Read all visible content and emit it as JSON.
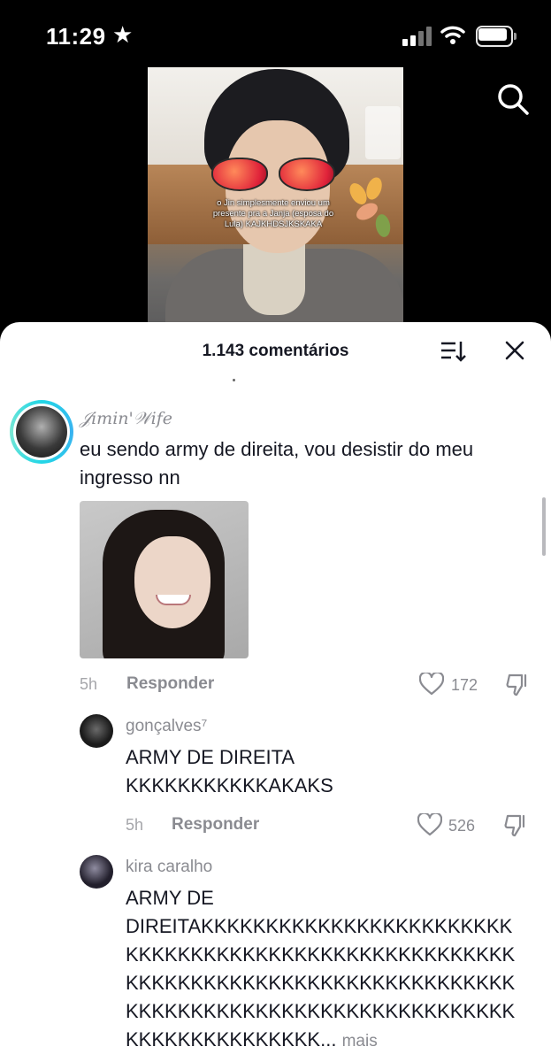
{
  "status_bar": {
    "time": "11:29",
    "star_icon": "★"
  },
  "video": {
    "caption": "o Jin simplesmente enviou um presente pra a Janja (esposa do Lula) KAJKHDSJKSKAKA"
  },
  "comments_panel": {
    "title": "1.143 comentários",
    "comments": [
      {
        "username": "𝒥imin'𝒲ife",
        "text": "eu sendo army de direita, vou desistir do meu ingresso nn",
        "time": "5h",
        "reply_label": "Responder",
        "likes": "172"
      }
    ],
    "replies": [
      {
        "username": "gonçalves⁷",
        "text_line1": "ARMY DE DIREITA",
        "text_line2": "KKKKKKKKKKKAKAKS",
        "time": "5h",
        "reply_label": "Responder",
        "likes": "526"
      },
      {
        "username": "kira caralho",
        "text_line1": "ARMY DE",
        "text_line2": "DIREITAKKKKKKKKKKKKKKKKKKKKKKKK",
        "text_line3": "KKKKKKKKKKKKKKKKKKKKKKKKKKKKKK",
        "text_line4": "KKKKKKKKKKKKKKKKKKKKKKKKKKKKKK",
        "text_line5": "KKKKKKKKKKKKKKKKKKKKKKKKKKKKKK",
        "text_line6": "KKKKKKKKKKKKKKK...",
        "more_label": "mais"
      }
    ]
  },
  "icons": {
    "search": "search-icon",
    "sort": "sort-icon",
    "close": "close-icon",
    "like": "heart-icon",
    "dislike": "thumbs-down-icon"
  }
}
